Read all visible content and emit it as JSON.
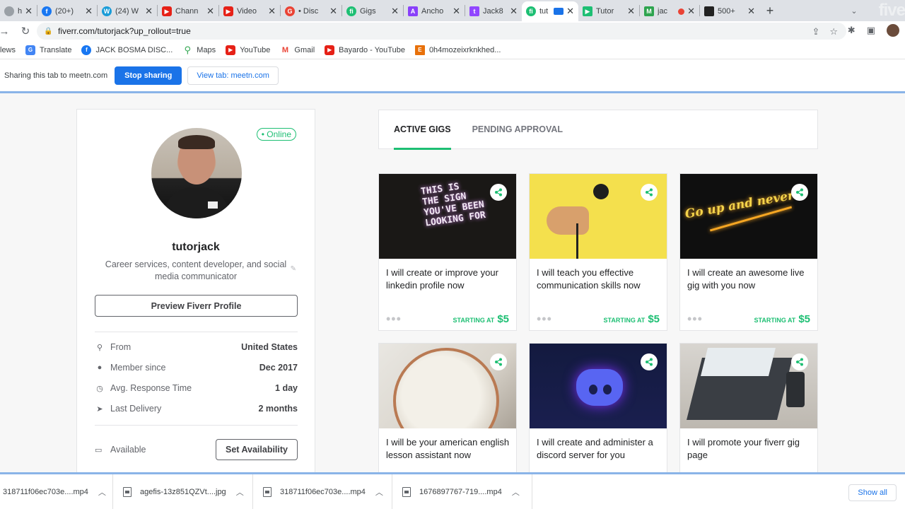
{
  "browser": {
    "tabs": [
      {
        "title": "https:/",
        "color": "#9aa0a6"
      },
      {
        "title": "(20+)",
        "color": "#1877f2"
      },
      {
        "title": "(24) W",
        "color": "#1a9cd8"
      },
      {
        "title": "Chann",
        "color": "#e62117"
      },
      {
        "title": "Video",
        "color": "#e62117"
      },
      {
        "title": "• Disc",
        "color": "#ea4335"
      },
      {
        "title": "Gigs",
        "color": "#1dbf73"
      },
      {
        "title": "Ancho",
        "color": "#8940fa"
      },
      {
        "title": "Jack8",
        "color": "#9146ff"
      },
      {
        "title": "tut",
        "color": "#1dbf73"
      },
      {
        "title": "Tutor",
        "color": "#1dbf73"
      },
      {
        "title": "jac",
        "color": "#2ea44f"
      },
      {
        "title": "500+",
        "color": "#222222"
      }
    ],
    "brand_corner": "five",
    "url": "fiverr.com/tutorjack?up_rollout=true",
    "bookmarks": [
      {
        "label": "lews",
        "color": "#9aa0a6",
        "letter": ""
      },
      {
        "label": "Translate",
        "color": "#4285f4",
        "letter": "G"
      },
      {
        "label": "JACK BOSMA DISC...",
        "color": "#1877f2",
        "letter": "f"
      },
      {
        "label": "Maps",
        "color": "#34a853",
        "letter": ""
      },
      {
        "label": "YouTube",
        "color": "#e62117",
        "letter": "▶"
      },
      {
        "label": "Gmail",
        "color": "#ea4335",
        "letter": "M"
      },
      {
        "label": "Bayardo - YouTube",
        "color": "#e62117",
        "letter": "▶"
      },
      {
        "label": "0h4mozeixrknkhed...",
        "color": "#e8710a",
        "letter": "E"
      }
    ]
  },
  "sharebar": {
    "text": "Sharing this tab to meetn.com",
    "stop_label": "Stop sharing",
    "view_label": "View tab: meetn.com"
  },
  "profile": {
    "status": "• Online",
    "username": "tutorjack",
    "description": "Career services, content developer, and social media communicator",
    "preview_label": "Preview Fiverr Profile",
    "stats": [
      {
        "icon": "location-pin-icon",
        "glyph": "⚲",
        "label": "From",
        "value": "United States"
      },
      {
        "icon": "user-icon",
        "glyph": "👤",
        "label": "Member since",
        "value": "Dec 2017"
      },
      {
        "icon": "clock-icon",
        "glyph": "◷",
        "label": "Avg. Response Time",
        "value": "1 day"
      },
      {
        "icon": "send-icon",
        "glyph": "➤",
        "label": "Last Delivery",
        "value": "2 months"
      }
    ],
    "availability_label": "Available",
    "set_availability_label": "Set Availability"
  },
  "gig_tabs": {
    "active": "ACTIVE GIGS",
    "pending": "PENDING APPROVAL"
  },
  "gigs": [
    {
      "title": "I will create or improve your linkedin profile now",
      "starting_label": "STARTING AT",
      "price": "$5",
      "neon": [
        "THIS IS",
        "THE SIGN",
        "YOU'VE BEEN",
        "LOOKING FOR"
      ]
    },
    {
      "title": "I will teach you effective communication skills now",
      "starting_label": "STARTING AT",
      "price": "$5"
    },
    {
      "title": "I will create an awesome live gig with you now",
      "starting_label": "STARTING AT",
      "price": "$5",
      "neon": [
        "Go up and never"
      ]
    },
    {
      "title": "I will be your american english lesson assistant now"
    },
    {
      "title": "I will create and administer a discord server for you"
    },
    {
      "title": "I will promote your fiverr gig page"
    }
  ],
  "downloads": {
    "items": [
      "318711f06ec703e....mp4",
      "agefis-13z851QZVt....jpg",
      "318711f06ec703e....mp4",
      "1676897767-719....mp4"
    ],
    "show_all": "Show all"
  }
}
